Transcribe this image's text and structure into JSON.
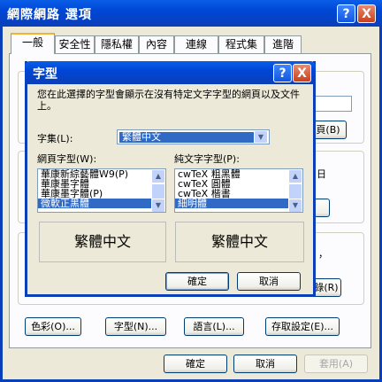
{
  "outer": {
    "title": "網際網路 選項",
    "help_btn": "?",
    "close_btn": "X",
    "tabs": [
      "一般",
      "安全性",
      "隱私權",
      "內容",
      "連線",
      "程式集",
      "進階"
    ],
    "bg_home_btn": "頁(B)",
    "bg_text_day": "日",
    "bg_text_comma": "，",
    "bg_text_r": "錄(R)",
    "bottom_buttons": {
      "colors": "色彩(O)...",
      "fonts": "字型(N)...",
      "languages": "語言(L)...",
      "accessibility": "存取設定(E)..."
    },
    "ok": "確定",
    "cancel": "取消",
    "apply": "套用(A)"
  },
  "dialog": {
    "title": "字型",
    "help_btn": "?",
    "close_btn": "X",
    "description": "您在此選擇的字型會顯示在沒有特定文字字型的網頁以及文件上。",
    "charset_label": "字集(L):",
    "charset_value": "繁體中文",
    "web_font_label": "網頁字型(W):",
    "plain_font_label": "純文字字型(P):",
    "web_fonts": [
      "華康新綜藝體W9(P)",
      "華康墨字體",
      "華康墨字體(P)",
      "微軟正黑體"
    ],
    "plain_fonts": [
      "cwTeX 粗黑體",
      "cwTeX 圓體",
      "cwTeX 楷書",
      "細明體"
    ],
    "web_preview": "繁體中文",
    "plain_preview": "繁體中文",
    "ok": "確定",
    "cancel": "取消"
  }
}
